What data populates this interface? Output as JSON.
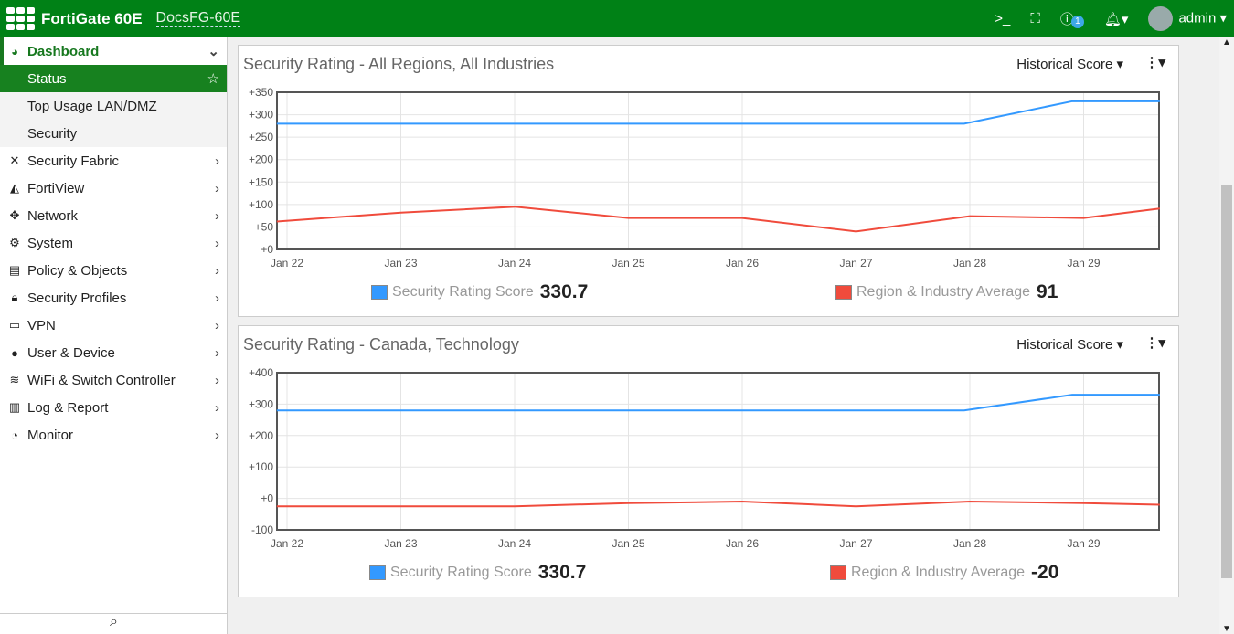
{
  "header": {
    "brand": "FortiGate 60E",
    "hostname": "DocsFG-60E",
    "help_badge": "1",
    "user": "admin"
  },
  "sidebar": {
    "items": [
      {
        "label": "Dashboard",
        "icon": "dashboard-icon"
      },
      {
        "label": "Status"
      },
      {
        "label": "Top Usage LAN/DMZ"
      },
      {
        "label": "Security"
      },
      {
        "label": "Security Fabric",
        "icon": "fabric-icon"
      },
      {
        "label": "FortiView",
        "icon": "chart-area-icon"
      },
      {
        "label": "Network",
        "icon": "arrows-icon"
      },
      {
        "label": "System",
        "icon": "gear-icon"
      },
      {
        "label": "Policy & Objects",
        "icon": "policy-icon"
      },
      {
        "label": "Security Profiles",
        "icon": "lock-icon"
      },
      {
        "label": "VPN",
        "icon": "laptop-icon"
      },
      {
        "label": "User & Device",
        "icon": "user-icon"
      },
      {
        "label": "WiFi & Switch Controller",
        "icon": "wifi-icon"
      },
      {
        "label": "Log & Report",
        "icon": "bar-chart-icon"
      },
      {
        "label": "Monitor",
        "icon": "pie-chart-icon"
      }
    ]
  },
  "colors": {
    "blue": "#3399ff",
    "red": "#f04b3c",
    "green": "#008116"
  },
  "chart_data": [
    {
      "type": "line",
      "title": "Security Rating - All Regions, All Industries",
      "dropdown": "Historical Score",
      "categories": [
        "Jan 22",
        "Jan 23",
        "Jan 24",
        "Jan 25",
        "Jan 26",
        "Jan 27",
        "Jan 28",
        "Jan 29"
      ],
      "ylim": [
        0,
        350
      ],
      "yticks": [
        "+0",
        "+50",
        "+100",
        "+150",
        "+200",
        "+250",
        "+300",
        "+350"
      ],
      "series": [
        {
          "name": "Security Rating Score",
          "value": "330.7",
          "x": [
            -0.09,
            5.95,
            6.9,
            7.67
          ],
          "y": [
            280,
            280,
            330,
            330
          ]
        },
        {
          "name": "Region & Industry Average",
          "value": "91",
          "x": [
            -0.09,
            1,
            2,
            3,
            4,
            5,
            6,
            7,
            7.67
          ],
          "y": [
            62,
            82,
            95,
            70,
            70,
            40,
            74,
            70,
            91
          ]
        }
      ]
    },
    {
      "type": "line",
      "title": "Security Rating - Canada, Technology",
      "dropdown": "Historical Score",
      "categories": [
        "Jan 22",
        "Jan 23",
        "Jan 24",
        "Jan 25",
        "Jan 26",
        "Jan 27",
        "Jan 28",
        "Jan 29"
      ],
      "ylim": [
        -100,
        400
      ],
      "yticks": [
        "-100",
        "+0",
        "+100",
        "+200",
        "+300",
        "+400"
      ],
      "series": [
        {
          "name": "Security Rating Score",
          "value": "330.7",
          "x": [
            -0.09,
            5.95,
            6.9,
            7.67
          ],
          "y": [
            280,
            280,
            330,
            330
          ]
        },
        {
          "name": "Region & Industry Average",
          "value": "-20",
          "x": [
            -0.09,
            1,
            2,
            3,
            4,
            5,
            6,
            7,
            7.67
          ],
          "y": [
            -25,
            -25,
            -25,
            -15,
            -10,
            -25,
            -10,
            -15,
            -20
          ]
        }
      ]
    }
  ]
}
